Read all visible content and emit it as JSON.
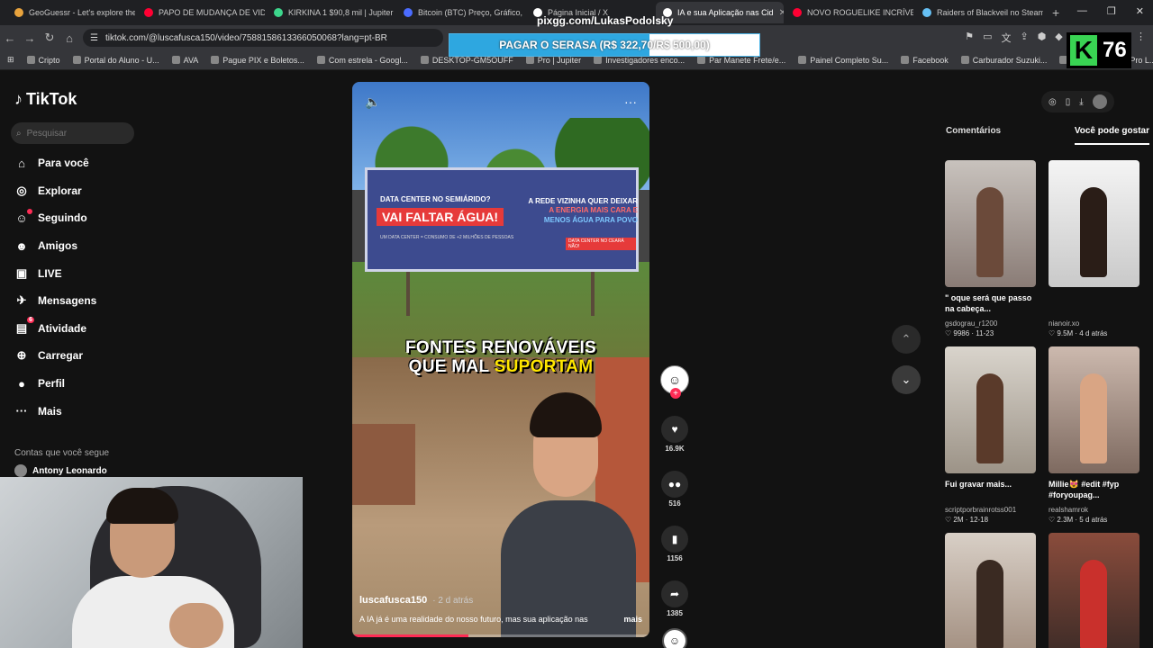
{
  "browser": {
    "tabs": [
      {
        "title": "GeoGuessr - Let's explore the",
        "color": "#e8a33d"
      },
      {
        "title": "PAPO DE MUDANÇA DE VIDA",
        "color": "#ff0033"
      },
      {
        "title": "KIRKINA 1 $90,8 mil | Jupiter",
        "color": "#3dd68c"
      },
      {
        "title": "Bitcoin (BTC) Preço, Gráfico, Ca",
        "color": "#4b6cff"
      },
      {
        "title": "Página Inicial / X",
        "color": "#ffffff"
      },
      {
        "title": "IA e sua Aplicação nas Cid",
        "color": "#ffffff",
        "active": true
      },
      {
        "title": "NOVO ROGUELIKE INCRÍVEL L",
        "color": "#ff0033"
      },
      {
        "title": "Raiders of Blackveil no Steam",
        "color": "#66c0f4"
      }
    ],
    "url": "tiktok.com/@luscafusca150/video/7588158613366050068?lang=pt-BR",
    "bookmarks": [
      "Cripto",
      "Portal do Aluno - U...",
      "AVA",
      "Pague PIX e Boletos...",
      "Com estrela - Googl...",
      "DESKTOP-GM5OUFF",
      "Pro | Jupiter",
      "Investigadores enco...",
      "Par Manete Frete/e...",
      "Painel Completo Su...",
      "Facebook",
      "Carburador Suzuki...",
      "Fabián Ruiz FC Pro L..."
    ]
  },
  "overlay": {
    "handle": "pixgg.com/LukasPodolsky",
    "goal_text": "PAGAR O SERASA (R$ 322,70/R$ 500,00)",
    "goal_progress": 0.6454,
    "k_count": "76"
  },
  "tiktok": {
    "logo": "TikTok",
    "search_placeholder": "Pesquisar",
    "nav": [
      {
        "label": "Para você",
        "icon": "⌂"
      },
      {
        "label": "Explorar",
        "icon": "◎"
      },
      {
        "label": "Seguindo",
        "icon": "☺",
        "dot": true
      },
      {
        "label": "Amigos",
        "icon": "☻"
      },
      {
        "label": "LIVE",
        "icon": "▣"
      },
      {
        "label": "Mensagens",
        "icon": "✈"
      },
      {
        "label": "Atividade",
        "icon": "▤",
        "badge": "6"
      },
      {
        "label": "Carregar",
        "icon": "⊕"
      },
      {
        "label": "Perfil",
        "icon": "●"
      },
      {
        "label": "Mais",
        "icon": "···"
      }
    ],
    "following_title": "Contas que você segue",
    "following_first": "Antony Leonardo",
    "video": {
      "billboard_left_top": "DATA CENTER NO SEMIÁRIDO?",
      "billboard_left_main": "VAI FALTAR ÁGUA!",
      "billboard_left_bottom": "UM DATA CENTER = CONSUMO DE +2 MILHÕES DE PESSOAS",
      "billboard_right_1": "A REDE VIZINHA QUER DEIXAR",
      "billboard_right_2": "A ENERGIA MAIS CARA E",
      "billboard_right_3": "MENOS ÁGUA PARA POVO",
      "billboard_right_bottom": "DATA CENTER NO CEARÁ NÃO!",
      "caption_line1": "FONTES RENOVÁVEIS",
      "caption_line2_a": "QUE MAL ",
      "caption_line2_b": "SUPORTAM",
      "author": "luscafusca150",
      "ago": "· 2 d atrás",
      "description": "A IA já é uma realidade do nosso futuro, mas sua aplicação nas",
      "more": "mais",
      "progress": 0.39
    },
    "actions": {
      "likes": "16.9K",
      "comments": "516",
      "saves": "1156",
      "shares": "1385"
    },
    "right_panel": {
      "tab_comments": "Comentários",
      "tab_suggested": "Você pode gostar",
      "cards": [
        {
          "title": "\" oque será que passo na cabeça...",
          "author": "gsdograu_r1200",
          "stats": "♡ 9986 · 11-23"
        },
        {
          "title": "",
          "author": "nianoir.xo",
          "stats": "♡ 9.5M · 4 d atrás"
        },
        {
          "title": "Fui gravar mais...",
          "author": "scriptporbrainrotss001",
          "stats": "♡ 2M · 12-18"
        },
        {
          "title": "Millie😻 #edit #fyp #foryoupag...",
          "author": "realshamrok",
          "stats": "♡ 2.3M · 5 d atrás"
        },
        {
          "title": "",
          "author": "",
          "stats": ""
        },
        {
          "title": "",
          "author": "",
          "stats": ""
        }
      ]
    }
  }
}
